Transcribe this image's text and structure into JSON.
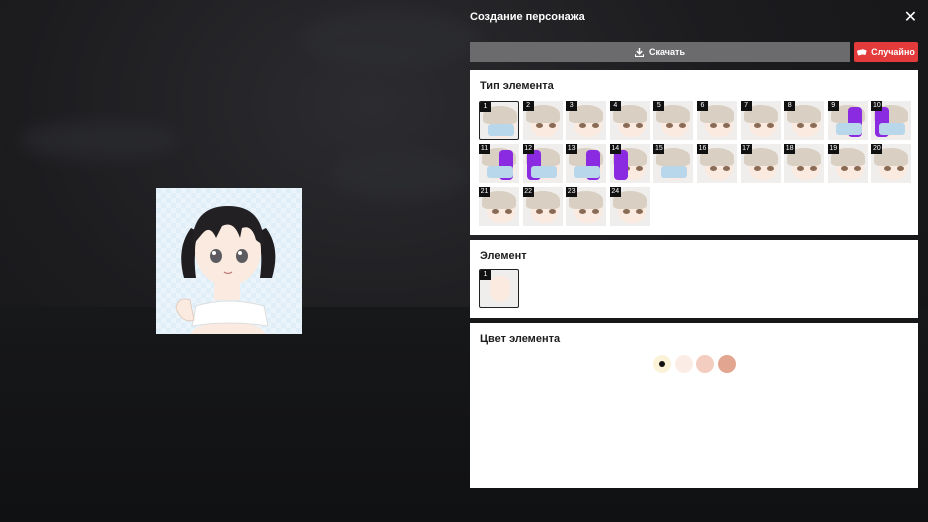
{
  "header": {
    "title": "Создание персонажа"
  },
  "toolbar": {
    "download_label": "Скачать",
    "random_label": "Случайно"
  },
  "colors": {
    "random_button": "#e33b3b",
    "download_button": "#6b6b6e"
  },
  "element_types": {
    "heading": "Тип элемента",
    "items": [
      "1",
      "2",
      "3",
      "4",
      "5",
      "6",
      "7",
      "8",
      "9",
      "10",
      "11",
      "12",
      "13",
      "14",
      "15",
      "16",
      "17",
      "18",
      "19",
      "20",
      "21",
      "22",
      "23",
      "24"
    ],
    "selected": "1"
  },
  "elements": {
    "heading": "Элемент",
    "items": [
      "1"
    ],
    "selected": "1"
  },
  "element_color": {
    "heading": "Цвет элемента",
    "swatches": [
      "#fcf2d8",
      "#fbece6",
      "#f3cdbf",
      "#e2a690"
    ],
    "selected_index": 0
  }
}
